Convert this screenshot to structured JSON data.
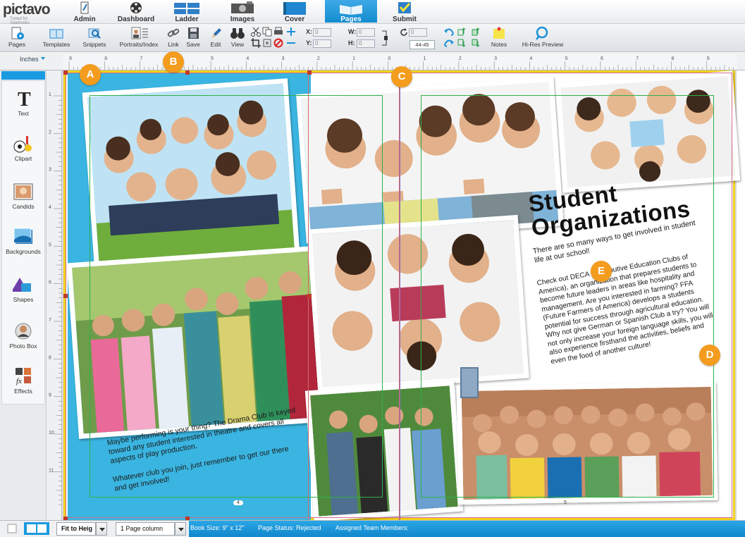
{
  "app": {
    "logo": "pictavo",
    "tagline": "Tuned for Yearbooks"
  },
  "nav": [
    {
      "label": "Admin",
      "icon": "admin-pencil-icon"
    },
    {
      "label": "Dashboard",
      "icon": "dashboard-film-reel-icon"
    },
    {
      "label": "Ladder",
      "icon": "ladder-pages-icon"
    },
    {
      "label": "Images",
      "icon": "images-camera-icon"
    },
    {
      "label": "Cover",
      "icon": "cover-book-icon"
    },
    {
      "label": "Pages",
      "icon": "pages-book-icon",
      "active": true
    },
    {
      "label": "Submit",
      "icon": "submit-check-icon"
    }
  ],
  "toolbar": {
    "pages": "Pages",
    "templates": "Templates",
    "snippets": "Snippets",
    "portraits": "Portraits/Index",
    "link": "Link",
    "save": "Save",
    "edit": "Edit",
    "view": "View",
    "x_label": "X:",
    "y_label": "Y:",
    "w_label": "W:",
    "h_label": "H:",
    "x_value": "0",
    "y_value": "0",
    "w_value": "0",
    "h_value": "0",
    "rotation_value": "0",
    "page_range": "44-45",
    "notes": "Notes",
    "hires": "Hi-Res Preview"
  },
  "ruler": {
    "units": "Inches",
    "h_ticks": [
      "9",
      "8",
      "7",
      "6",
      "5",
      "4",
      "3",
      "2",
      "1",
      "0",
      "1",
      "2",
      "3",
      "4",
      "5",
      "6",
      "7",
      "8",
      "9"
    ],
    "v_ticks": [
      "1",
      "2",
      "3",
      "4",
      "5",
      "6",
      "7",
      "8",
      "9",
      "10",
      "11"
    ]
  },
  "sidebar": [
    {
      "label": "Text",
      "icon": "text-tool-icon"
    },
    {
      "label": "Clipart",
      "icon": "clipart-icon"
    },
    {
      "label": "Candids",
      "icon": "candids-icon"
    },
    {
      "label": "Backgrounds",
      "icon": "backgrounds-icon"
    },
    {
      "label": "Shapes",
      "icon": "shapes-icon"
    },
    {
      "label": "Photo Box",
      "icon": "photo-box-icon"
    },
    {
      "label": "Effects",
      "icon": "effects-icon"
    }
  ],
  "spread": {
    "markers": [
      "A",
      "B",
      "C",
      "D",
      "E"
    ],
    "headline_line1": "Student",
    "headline_line2": "Organizations",
    "intro_text": "There are so many ways to get involved in student life at our school!",
    "body_text": "Check out DECA (Distributive Education Clubs of America), an organization that prepares students to become future leaders in areas like hospitality and management. Are you interested in farming? FFA (Future Farmers of America) develops a students potential for success through agricultural education. Why not give German or Spanish Club a try? You will not only increase your foreign language skills, you will also experience firsthand the activities, beliefs and even the food of another culture!",
    "drama_text": "Maybe performing is your thing? The Drama Club is keyed toward any student interested in theatre and covers all aspects of play production.",
    "closing_text": "Whatever club you join, just remember to get our there and get involved!",
    "left_page_number": "4",
    "right_page_number": "5"
  },
  "status": {
    "zoom": "Fit to Heig",
    "columns": "1 Page column",
    "book_size": "Book Size: 9\" x 12\"",
    "page_status": "Page Status: Rejected",
    "team": "Assigned Team Members:"
  },
  "colors": {
    "accent_blue": "#1a9ae0",
    "page_bg_blue": "#3ab5e1",
    "marker_orange": "#f39c1e",
    "spread_border": "#f2d21c"
  }
}
